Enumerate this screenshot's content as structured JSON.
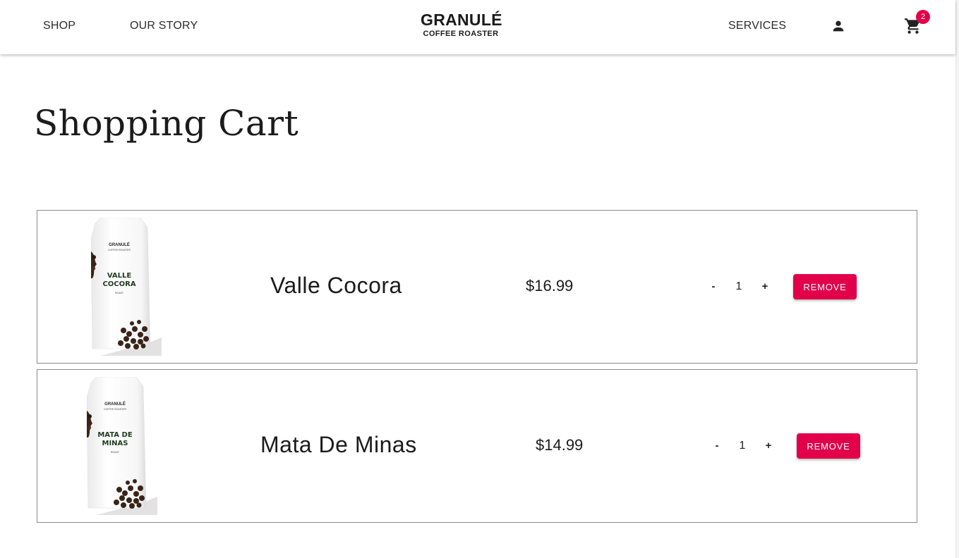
{
  "header": {
    "nav_shop": "SHOP",
    "nav_story": "OUR STORY",
    "nav_services": "SERVICES",
    "logo_main": "GRANULÉ",
    "logo_sub": "COFFEE ROASTER",
    "account_icon": "person-icon",
    "cart_icon": "shopping-cart-icon",
    "cart_count": "2"
  },
  "page": {
    "title": "Shopping Cart"
  },
  "cart": {
    "items": [
      {
        "name": "Valle Cocora",
        "price": "$16.99",
        "quantity": "1",
        "minus_label": "-",
        "plus_label": "+",
        "remove_label": "REMOVE",
        "bag_brand": "GRANULÉ",
        "bag_sub": "COFFEE ROASTER",
        "bag_line1": "VALLE",
        "bag_line2": "COCORA",
        "bag_roast": "ROAST"
      },
      {
        "name": "Mata De Minas",
        "price": "$14.99",
        "quantity": "1",
        "minus_label": "-",
        "plus_label": "+",
        "remove_label": "REMOVE",
        "bag_brand": "GRANULÉ",
        "bag_sub": "COFFEE ROASTER",
        "bag_line1": "MATA DE",
        "bag_line2": "MINAS",
        "bag_roast": "ROAST"
      }
    ]
  },
  "colors": {
    "accent": "#e2004b",
    "bag_label_green": "#1f3b1f",
    "text": "#1b1b1b"
  }
}
